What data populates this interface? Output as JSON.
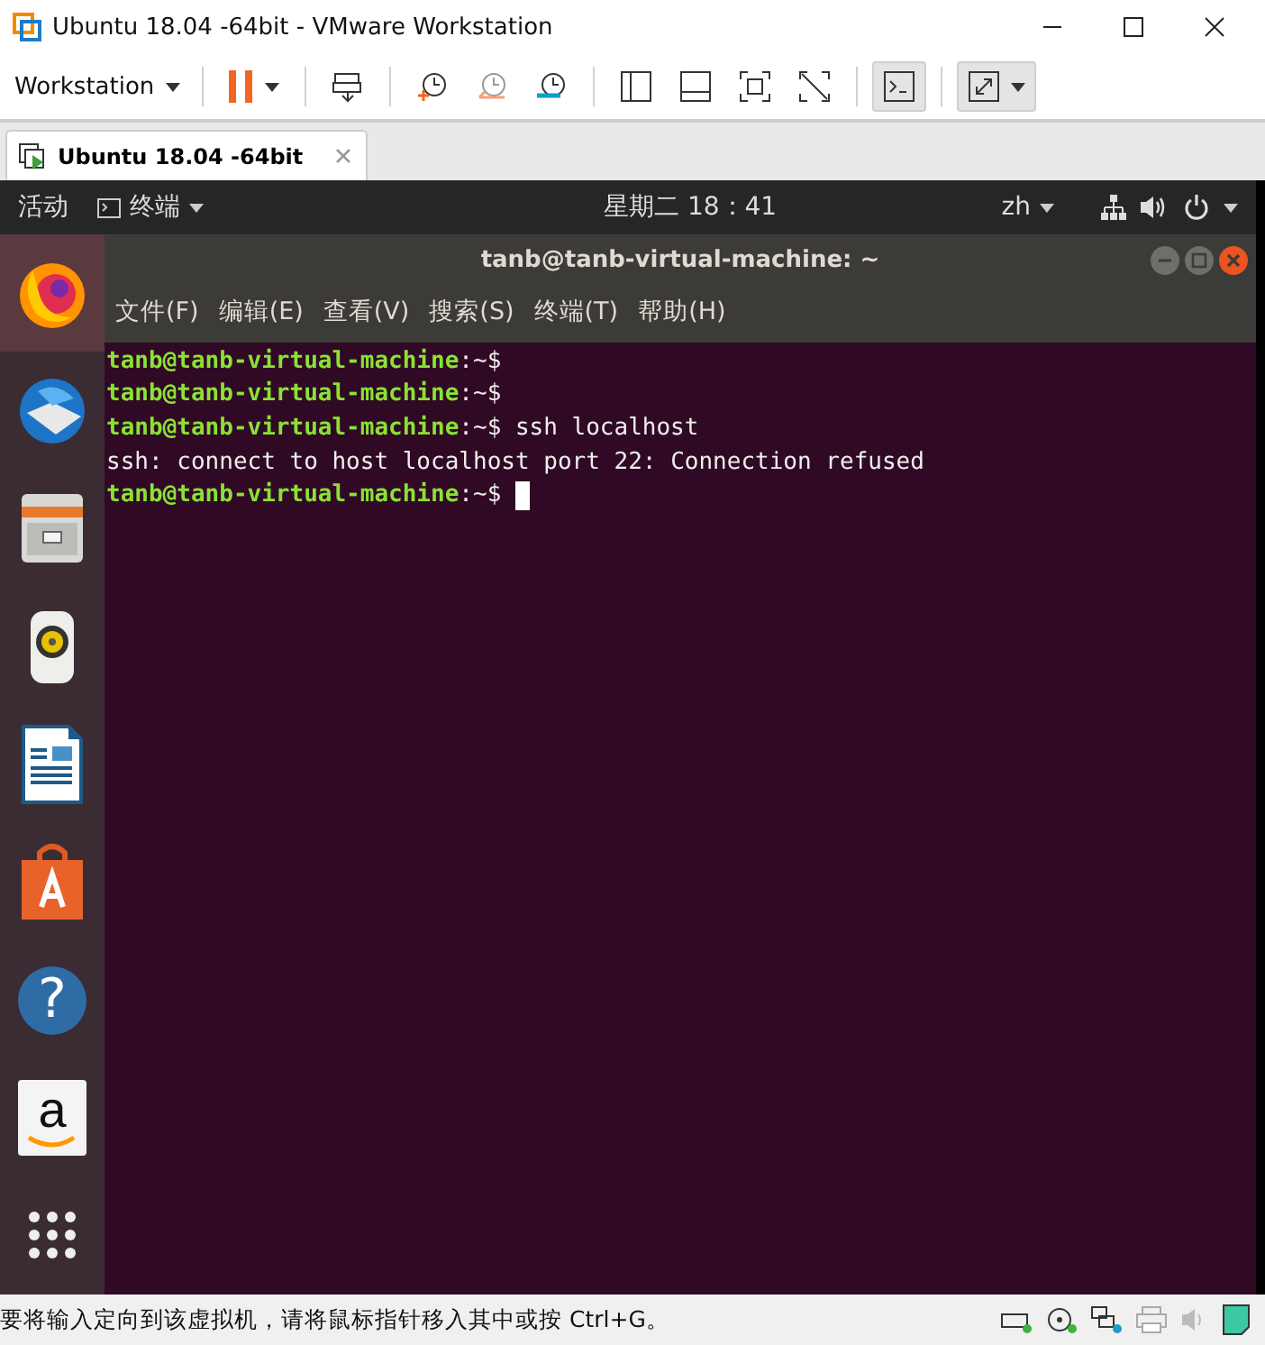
{
  "window": {
    "title": "Ubuntu 18.04 -64bit - VMware Workstation"
  },
  "toolbar": {
    "menu": "Workstation",
    "buttons": [
      {
        "kind": "pause",
        "pressed": false,
        "dropdown": true
      },
      {
        "kind": "send-keys",
        "pressed": false,
        "dropdown": false
      },
      {
        "kind": "snapshot-take",
        "pressed": false,
        "dropdown": false
      },
      {
        "kind": "snapshot-revert",
        "pressed": false,
        "dropdown": false
      },
      {
        "kind": "snapshot-manage",
        "pressed": false,
        "dropdown": false
      },
      {
        "kind": "view-library",
        "pressed": false,
        "dropdown": false
      },
      {
        "kind": "view-thumbnail",
        "pressed": false,
        "dropdown": false
      },
      {
        "kind": "view-fullscreen",
        "pressed": false,
        "dropdown": false
      },
      {
        "kind": "view-unity",
        "pressed": false,
        "dropdown": false
      },
      {
        "kind": "console",
        "pressed": true,
        "dropdown": false
      },
      {
        "kind": "stretch",
        "pressed": true,
        "dropdown": true
      }
    ]
  },
  "tabs": [
    {
      "label": "Ubuntu 18.04 -64bit",
      "selected": true
    }
  ],
  "ubuntu_bar": {
    "activities": "活动",
    "app_menu": "终端",
    "clock": "星期二 18：41",
    "input_method": "zh"
  },
  "dock": [
    {
      "kind": "firefox",
      "selected": true
    },
    {
      "kind": "thunderbird",
      "selected": false
    },
    {
      "kind": "files",
      "selected": false
    },
    {
      "kind": "rhythmbox",
      "selected": false
    },
    {
      "kind": "writer",
      "selected": false
    },
    {
      "kind": "software",
      "selected": false
    },
    {
      "kind": "help",
      "selected": false,
      "glyph": "?"
    },
    {
      "kind": "amazon",
      "selected": false,
      "glyph": "a"
    },
    {
      "kind": "apps",
      "selected": false
    }
  ],
  "terminal": {
    "title": "tanb@tanb-virtual-machine: ~",
    "menu": [
      "文件(F)",
      "编辑(E)",
      "查看(V)",
      "搜索(S)",
      "终端(T)",
      "帮助(H)"
    ],
    "lines": [
      {
        "kind": "prompt",
        "prompt": "tanb@tanb-virtual-machine",
        "path": ":~$"
      },
      {
        "kind": "prompt",
        "prompt": "tanb@tanb-virtual-machine",
        "path": ":~$"
      },
      {
        "kind": "prompt",
        "prompt": "tanb@tanb-virtual-machine",
        "path": ":~$",
        "command": "ssh localhost"
      },
      {
        "kind": "output",
        "text": "ssh: connect to host localhost port 22: Connection refused"
      },
      {
        "kind": "prompt",
        "prompt": "tanb@tanb-virtual-machine",
        "path": ":~$",
        "cursor": true
      }
    ]
  },
  "status_bar": {
    "message": "要将输入定向到该虚拟机，请将鼠标指针移入其中或按 Ctrl+G。"
  }
}
